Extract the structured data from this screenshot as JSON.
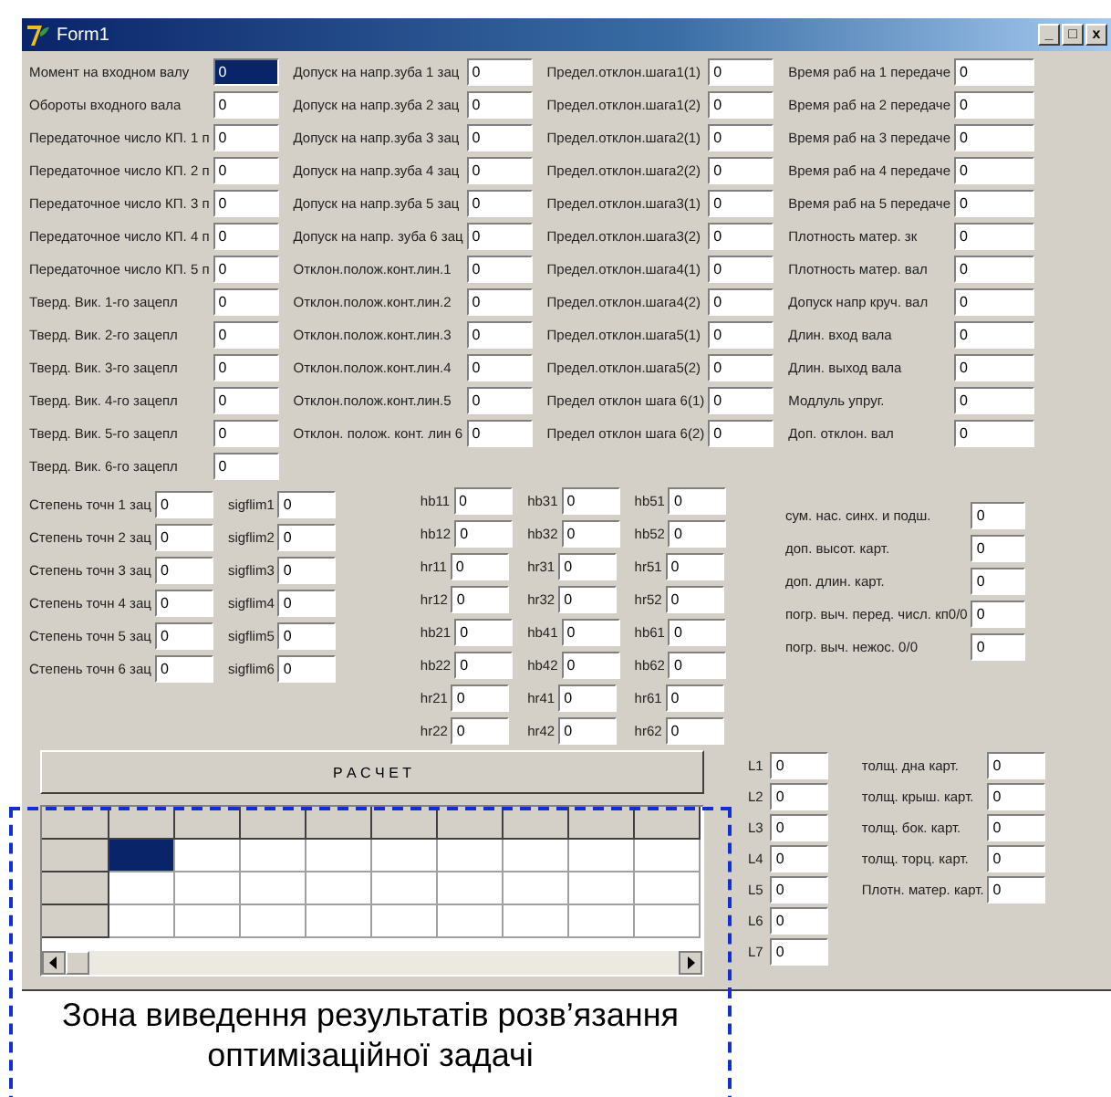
{
  "window": {
    "title": "Form1",
    "controls": [
      "_",
      "□",
      "x"
    ]
  },
  "top_columns": [
    [
      {
        "label": "Момент на входном валу",
        "value": "0",
        "selected": true
      },
      {
        "label": "Обороты входного вала",
        "value": "0",
        "selected": false
      },
      {
        "label": "Передаточное число КП. 1 п",
        "value": "0",
        "selected": false
      },
      {
        "label": "Передаточное число КП. 2 п",
        "value": "0",
        "selected": false
      },
      {
        "label": "Передаточное число КП. 3 п",
        "value": "0",
        "selected": false
      },
      {
        "label": "Передаточное число КП. 4 п",
        "value": "0",
        "selected": false
      },
      {
        "label": "Передаточное число КП. 5 п",
        "value": "0",
        "selected": false
      },
      {
        "label": "Тверд. Вик. 1-го зацепл",
        "value": "0",
        "selected": false
      },
      {
        "label": "Тверд. Вик. 2-го зацепл",
        "value": "0",
        "selected": false
      },
      {
        "label": "Тверд. Вик.  3-го зацепл",
        "value": "0",
        "selected": false
      },
      {
        "label": "Тверд. Вик.  4-го зацепл",
        "value": "0",
        "selected": false
      },
      {
        "label": "Тверд. Вик.  5-го зацепл",
        "value": "0",
        "selected": false
      },
      {
        "label": "Тверд. Вик.  6-го зацепл",
        "value": "0",
        "selected": false
      }
    ],
    [
      {
        "label": "Допуск на напр.зуба 1 зац",
        "value": "0"
      },
      {
        "label": "Допуск на напр.зуба 2 зац",
        "value": "0"
      },
      {
        "label": "Допуск на напр.зуба 3 зац",
        "value": "0"
      },
      {
        "label": "Допуск на напр.зуба 4 зац",
        "value": "0"
      },
      {
        "label": "Допуск на напр.зуба 5 зац",
        "value": "0"
      },
      {
        "label": "Допуск на напр. зуба 6 зац",
        "value": "0"
      },
      {
        "label": "Отклон.полож.конт.лин.1",
        "value": "0"
      },
      {
        "label": "Отклон.полож.конт.лин.2",
        "value": "0"
      },
      {
        "label": "Отклон.полож.конт.лин.3",
        "value": "0"
      },
      {
        "label": "Отклон.полож.конт.лин.4",
        "value": "0"
      },
      {
        "label": "Отклон.полож.конт.лин.5",
        "value": "0"
      },
      {
        "label": "Отклон. полож. конт. лин 6",
        "value": "0"
      }
    ],
    [
      {
        "label": "Предел.отклон.шага1(1)",
        "value": "0"
      },
      {
        "label": "Предел.отклон.шага1(2)",
        "value": "0"
      },
      {
        "label": "Предел.отклон.шага2(1)",
        "value": "0"
      },
      {
        "label": "Предел.отклон.шага2(2)",
        "value": "0"
      },
      {
        "label": "Предел.отклон.шага3(1)",
        "value": "0"
      },
      {
        "label": "Предел.отклон.шага3(2)",
        "value": "0"
      },
      {
        "label": "Предел.отклон.шага4(1)",
        "value": "0"
      },
      {
        "label": "Предел.отклон.шага4(2)",
        "value": "0"
      },
      {
        "label": "Предел.отклон.шага5(1)",
        "value": "0"
      },
      {
        "label": "Предел.отклон.шага5(2)",
        "value": "0"
      },
      {
        "label": "Предел отклон шага 6(1)",
        "value": "0"
      },
      {
        "label": "Предел отклон шага 6(2)",
        "value": "0"
      }
    ],
    [
      {
        "label": "Время раб на 1 передаче",
        "value": "0"
      },
      {
        "label": "Время раб на 2 передаче",
        "value": "0"
      },
      {
        "label": "Время раб на 3 передаче",
        "value": "0"
      },
      {
        "label": "Время раб на 4 передаче",
        "value": "0"
      },
      {
        "label": "Время раб на 5 передаче",
        "value": "0"
      },
      {
        "label": "Плотность матер. зк",
        "value": "0"
      },
      {
        "label": "Плотность матер. вал",
        "value": "0"
      },
      {
        "label": "Допуск напр круч. вал",
        "value": "0"
      },
      {
        "label": "Длин. вход вала",
        "value": "0"
      },
      {
        "label": "Длин. выход вала",
        "value": "0"
      },
      {
        "label": "Модлуль упруг.",
        "value": "0"
      },
      {
        "label": "Доп. отклон. вал",
        "value": "0"
      }
    ]
  ],
  "middle_columns": [
    [
      {
        "label": "Степень точн 1 зац",
        "value": "0"
      },
      {
        "label": "Степень точн 2 зац",
        "value": "0"
      },
      {
        "label": "Степень точн 3 зац",
        "value": "0"
      },
      {
        "label": "Степень точн 4 зац",
        "value": "0"
      },
      {
        "label": "Степень точн 5 зац",
        "value": "0"
      },
      {
        "label": "Степень точн 6 зац",
        "value": "0"
      }
    ],
    [
      {
        "label": "sigflim1",
        "value": "0"
      },
      {
        "label": "sigflim2",
        "value": "0"
      },
      {
        "label": "sigflim3",
        "value": "0"
      },
      {
        "label": "sigflim4",
        "value": "0"
      },
      {
        "label": "sigflim5",
        "value": "0"
      },
      {
        "label": "sigflim6",
        "value": "0"
      }
    ],
    [
      {
        "label": "hb11",
        "value": "0"
      },
      {
        "label": "hb12",
        "value": "0"
      },
      {
        "label": "hr11",
        "value": "0"
      },
      {
        "label": "hr12",
        "value": "0"
      },
      {
        "label": "hb21",
        "value": "0"
      },
      {
        "label": "hb22",
        "value": "0"
      },
      {
        "label": "hr21",
        "value": "0"
      },
      {
        "label": "hr22",
        "value": "0"
      }
    ],
    [
      {
        "label": "hb31",
        "value": "0"
      },
      {
        "label": "hb32",
        "value": "0"
      },
      {
        "label": "hr31",
        "value": "0"
      },
      {
        "label": "hr32",
        "value": "0"
      },
      {
        "label": "hb41",
        "value": "0"
      },
      {
        "label": "hb42",
        "value": "0"
      },
      {
        "label": "hr41",
        "value": "0"
      },
      {
        "label": "hr42",
        "value": "0"
      }
    ],
    [
      {
        "label": "hb51",
        "value": "0"
      },
      {
        "label": "hb52",
        "value": "0"
      },
      {
        "label": "hr51",
        "value": "0"
      },
      {
        "label": "hr52",
        "value": "0"
      },
      {
        "label": "hb61",
        "value": "0"
      },
      {
        "label": "hb62",
        "value": "0"
      },
      {
        "label": "hr61",
        "value": "0"
      },
      {
        "label": "hr62",
        "value": "0"
      }
    ]
  ],
  "side_fields": [
    {
      "label": "сум. нас. синх. и подш.",
      "value": "0"
    },
    {
      "label": "доп. высот. карт.",
      "value": "0"
    },
    {
      "label": "доп. длин. карт.",
      "value": "0"
    },
    {
      "label": "погр. выч. перед. числ. кп0/0",
      "value": "0"
    },
    {
      "label": "погр. выч. нежос. 0/0",
      "value": "0"
    }
  ],
  "calculate_button": "Р А С Ч Е Т",
  "results_grid": {
    "rows": [
      {
        "cells": [
          {
            "selected": true
          },
          {
            "selected": false
          },
          {
            "selected": false
          },
          {
            "selected": false
          },
          {
            "selected": false
          },
          {
            "selected": false
          },
          {
            "selected": false
          },
          {
            "selected": false
          },
          {
            "selected": false
          }
        ]
      },
      {
        "cells": [
          {
            "selected": false
          },
          {
            "selected": false
          },
          {
            "selected": false
          },
          {
            "selected": false
          },
          {
            "selected": false
          },
          {
            "selected": false
          },
          {
            "selected": false
          },
          {
            "selected": false
          },
          {
            "selected": false
          }
        ]
      },
      {
        "cells": [
          {
            "selected": false
          },
          {
            "selected": false
          },
          {
            "selected": false
          },
          {
            "selected": false
          },
          {
            "selected": false
          },
          {
            "selected": false
          },
          {
            "selected": false
          },
          {
            "selected": false
          },
          {
            "selected": false
          }
        ]
      }
    ]
  },
  "length_fields": [
    {
      "label": "L1",
      "value": "0"
    },
    {
      "label": "L2",
      "value": "0"
    },
    {
      "label": "L3",
      "value": "0"
    },
    {
      "label": "L4",
      "value": "0"
    },
    {
      "label": "L5",
      "value": "0"
    },
    {
      "label": "L6",
      "value": "0"
    },
    {
      "label": "L7",
      "value": "0"
    }
  ],
  "thickness_fields": [
    {
      "label": "толщ. дна карт.",
      "value": "0"
    },
    {
      "label": "толщ. крыш. карт.",
      "value": "0"
    },
    {
      "label": "толщ. бок. карт.",
      "value": "0"
    },
    {
      "label": "толщ. торц. карт.",
      "value": "0"
    },
    {
      "label": "Плотн. матер. карт.",
      "value": "0"
    }
  ],
  "caption": "Зона виведення результатів розв’язання оптимізаційної задачі"
}
